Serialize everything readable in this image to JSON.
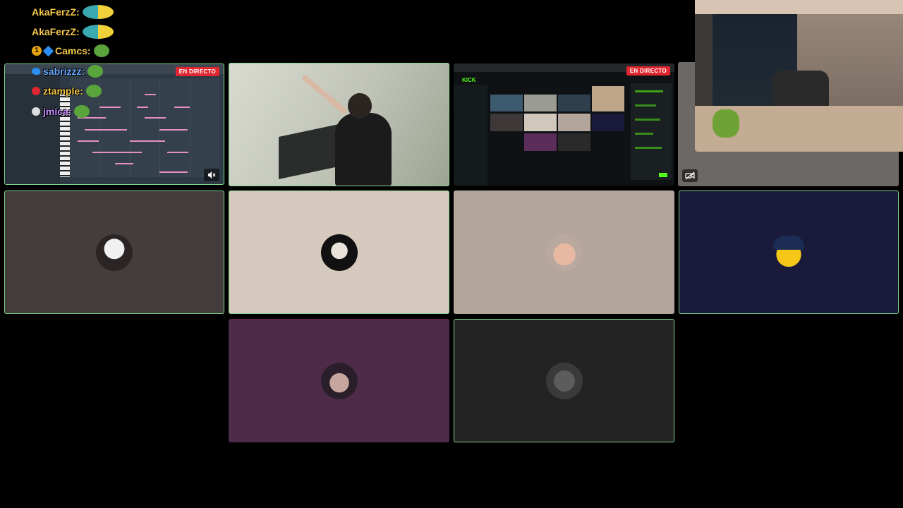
{
  "chat": {
    "messages": [
      {
        "user": "AkaFerzZ:",
        "color": "#f3c64a"
      },
      {
        "user": "AkaFerzZ:",
        "color": "#f3c64a"
      },
      {
        "user": "Camcs:",
        "color": "#f3c64a",
        "badge": "1"
      },
      {
        "user": "sabrizzz:",
        "color": "#6aa9ff"
      },
      {
        "user": "ztample:",
        "color": "#f3c64a"
      },
      {
        "user": "jmica:",
        "color": "#c58bff"
      }
    ]
  },
  "tiles": {
    "screen_share_1": {
      "live_label": "EN DIRECTO",
      "kind": "piano-roll screen share"
    },
    "screen_share_2": {
      "live_label": "EN DIRECTO",
      "site_logo": "KICK"
    },
    "participants": [
      {
        "bg": "#433d3e"
      },
      {
        "bg": "#d6c9bd"
      },
      {
        "bg": "#b3a59b"
      },
      {
        "bg": "#1a1b3a"
      },
      {
        "bg": "#4e2b48"
      },
      {
        "bg": "#232323"
      }
    ],
    "camera_bg": "#6c6866"
  },
  "icons": {
    "muted": "speaker-muted-icon",
    "camera_off": "camera-off-icon"
  },
  "colors": {
    "speaking_border": "#7fd38a",
    "live_red": "#e0262e"
  }
}
